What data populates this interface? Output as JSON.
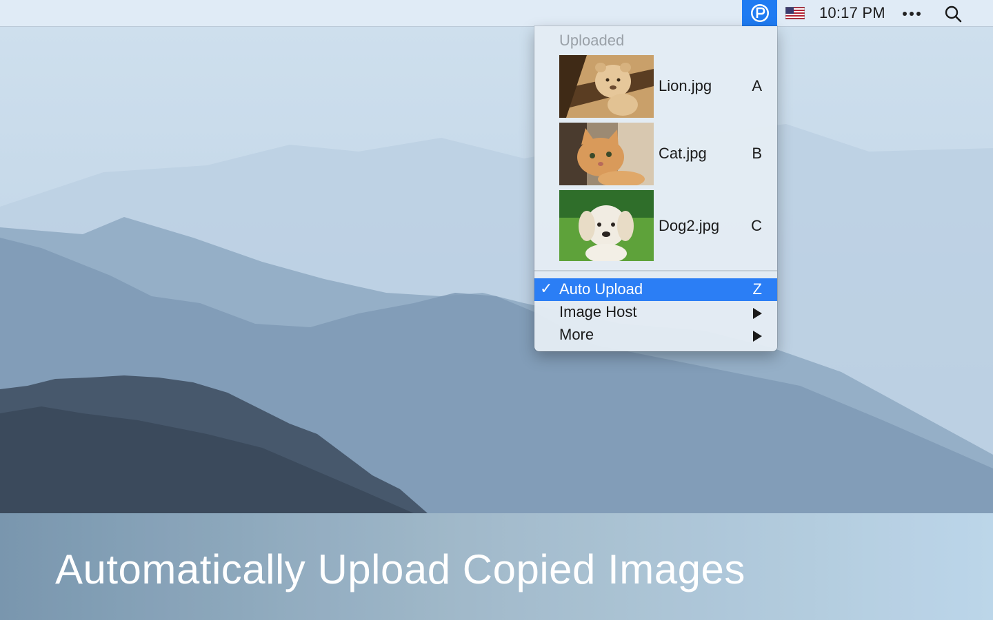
{
  "menubar": {
    "app_icon": "p-logo-icon",
    "flag_icon": "us-flag-icon",
    "clock": "10:17 PM",
    "more_icon": "ellipsis-icon",
    "search_icon": "search-icon",
    "app_icon_color": "#1f7bf2"
  },
  "dropdown": {
    "header": "Uploaded",
    "items": [
      {
        "name": "Lion.jpg",
        "key": "A",
        "thumbnail": "lion-cub-photo"
      },
      {
        "name": "Cat.jpg",
        "key": "B",
        "thumbnail": "kitten-photo"
      },
      {
        "name": "Dog2.jpg",
        "key": "C",
        "thumbnail": "puppy-photo"
      }
    ],
    "actions": [
      {
        "label": "Auto Upload",
        "shortcut": "Z",
        "checked": true,
        "check": "✓"
      },
      {
        "label": "Image Host",
        "submenu": true
      },
      {
        "label": "More",
        "submenu": true
      }
    ],
    "highlight_color": "#2b7ef5"
  },
  "caption": "Automatically Upload Copied Images"
}
